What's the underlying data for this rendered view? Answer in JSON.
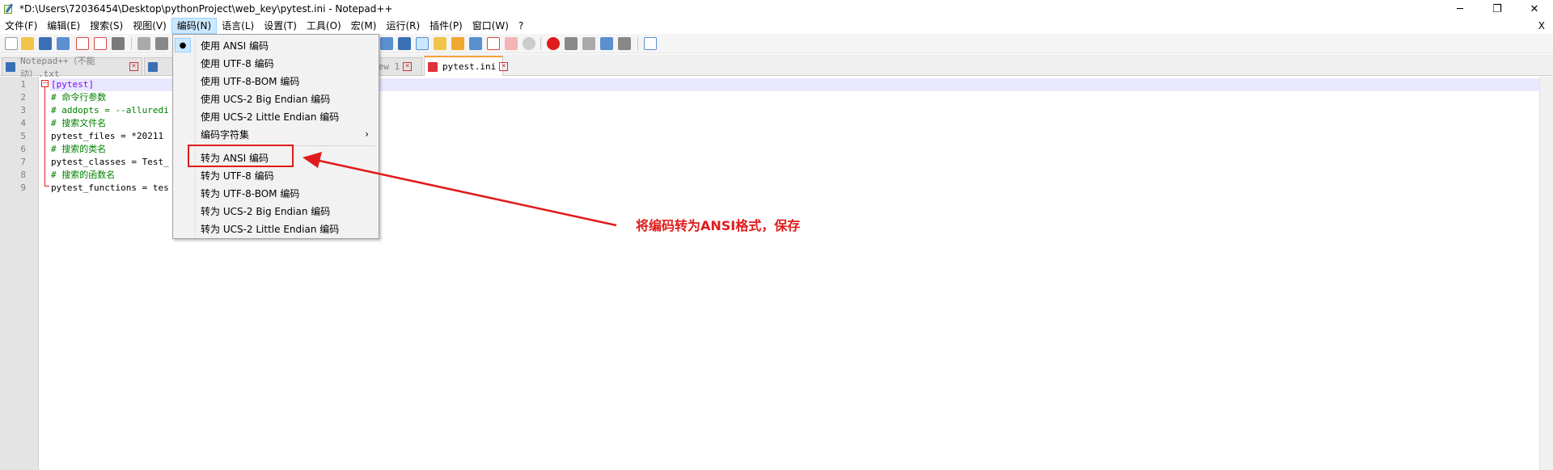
{
  "window": {
    "title": "*D:\\Users\\72036454\\Desktop\\pythonProject\\web_key\\pytest.ini - Notepad++",
    "minimize_glyph": "─",
    "restore_glyph": "❐",
    "close_glyph": "✕"
  },
  "menubar": {
    "items": [
      "文件(F)",
      "编辑(E)",
      "搜索(S)",
      "视图(V)",
      "编码(N)",
      "语言(L)",
      "设置(T)",
      "工具(O)",
      "宏(M)",
      "运行(R)",
      "插件(P)",
      "窗口(W)",
      "?"
    ],
    "active_item": "编码(N)",
    "close_glyph": "X"
  },
  "tabs": [
    {
      "label": "Notepad++（不能动）.txt",
      "color": "#3a6fb5",
      "active": false
    },
    {
      "label": "",
      "color": "#3a6fb5",
      "active": false
    },
    {
      "label": "new 1",
      "color": "#3a6fb5",
      "active": false
    },
    {
      "label": "pytest.ini",
      "color": "#e0313a",
      "active": true
    }
  ],
  "editor": {
    "line_numbers": [
      "1",
      "2",
      "3",
      "4",
      "5",
      "6",
      "7",
      "8",
      "9"
    ],
    "lines": [
      {
        "text": "[pytest]",
        "kind": "section"
      },
      {
        "text": "# 命令行参数",
        "kind": "comment"
      },
      {
        "text": "# addopts = --alluredi",
        "kind": "comment"
      },
      {
        "text": "# 搜索文件名",
        "kind": "comment"
      },
      {
        "text": "pytest_files = *20211",
        "kind": "plain"
      },
      {
        "text": "# 搜索的类名",
        "kind": "comment"
      },
      {
        "text": "pytest_classes = Test_",
        "kind": "plain"
      },
      {
        "text": "# 搜索的函数名",
        "kind": "comment"
      },
      {
        "text": "pytest_functions = tes",
        "kind": "plain"
      }
    ],
    "fold_glyph": "−"
  },
  "encoding_menu": {
    "items": [
      {
        "label": "使用 ANSI 编码",
        "checked": true
      },
      {
        "label": "使用 UTF-8 编码"
      },
      {
        "label": "使用 UTF-8-BOM 编码"
      },
      {
        "label": "使用 UCS-2 Big Endian 编码"
      },
      {
        "label": "使用 UCS-2 Little Endian 编码"
      },
      {
        "label": "编码字符集",
        "submenu": true
      },
      {
        "label": "转为 ANSI 编码",
        "highlighted": true
      },
      {
        "label": "转为 UTF-8 编码"
      },
      {
        "label": "转为 UTF-8-BOM 编码"
      },
      {
        "label": "转为 UCS-2 Big Endian 编码"
      },
      {
        "label": "转为 UCS-2 Little Endian 编码"
      }
    ],
    "check_glyph": "●",
    "submenu_glyph": "›"
  },
  "annotation": {
    "text": "将编码转为ANSI格式，保存",
    "color": "#e01b1b"
  }
}
